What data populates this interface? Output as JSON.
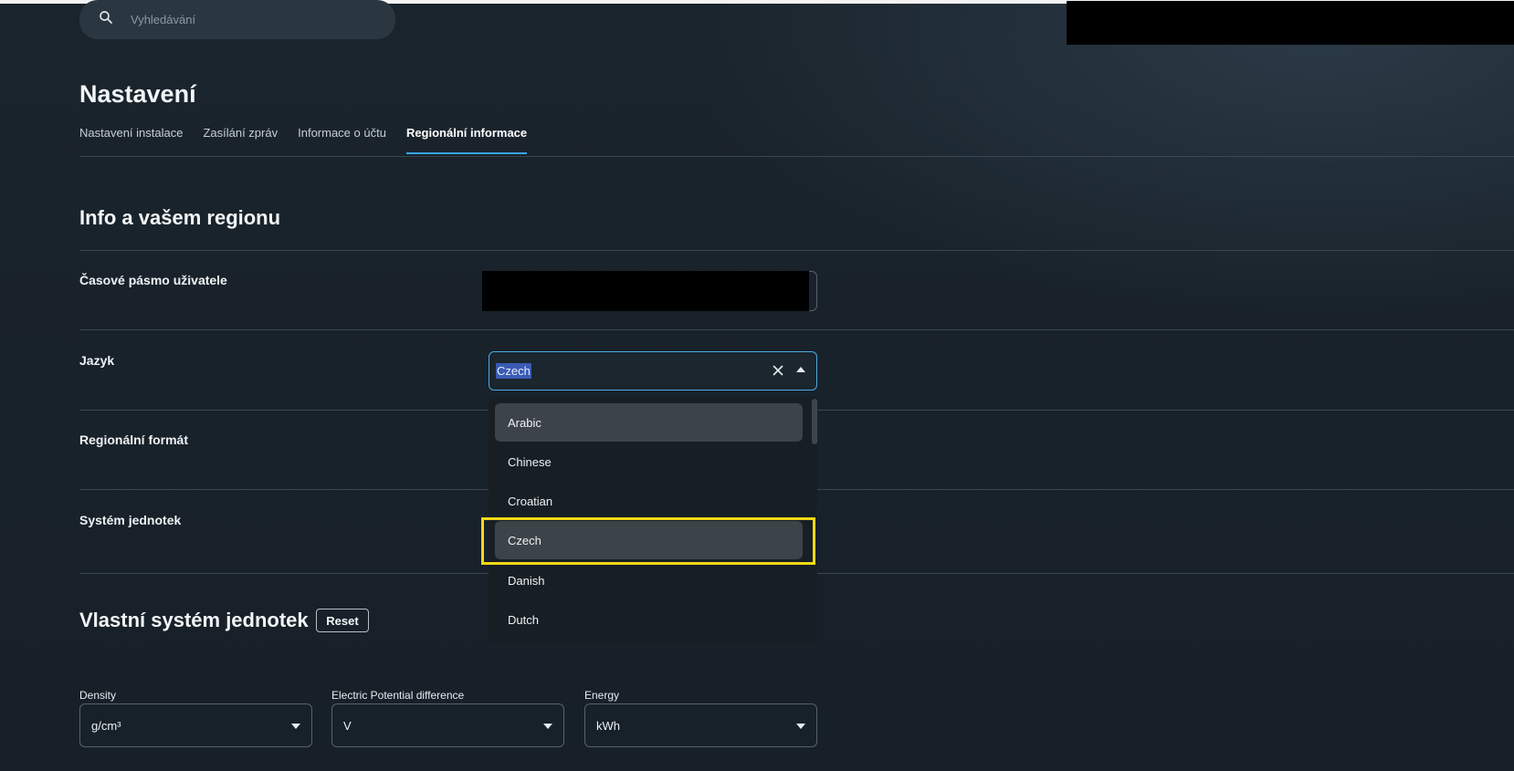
{
  "search": {
    "placeholder": "Vyhledávání"
  },
  "page_title": "Nastavení",
  "tabs": [
    {
      "label": "Nastavení instalace",
      "active": false
    },
    {
      "label": "Zasílání zpráv",
      "active": false
    },
    {
      "label": "Informace o účtu",
      "active": false
    },
    {
      "label": "Regionální informace",
      "active": true
    }
  ],
  "region": {
    "title": "Info a vašem regionu",
    "timezone_label": "Časové pásmo uživatele",
    "language_label": "Jazyk",
    "language_value": "Czech",
    "regional_format_label": "Regionální formát",
    "unit_system_label": "Systém jednotek"
  },
  "language_options": [
    "Arabic",
    "Chinese",
    "Croatian",
    "Czech",
    "Danish",
    "Dutch"
  ],
  "custom_units": {
    "title": "Vlastní systém jednotek",
    "reset_label": "Reset",
    "fields": [
      {
        "label": "Density",
        "value": "g/cm³"
      },
      {
        "label": "Electric Potential difference",
        "value": "V"
      },
      {
        "label": "Energy",
        "value": "kWh"
      }
    ]
  },
  "colors": {
    "accent": "#3aa6e6",
    "focus": "#f0d915"
  }
}
